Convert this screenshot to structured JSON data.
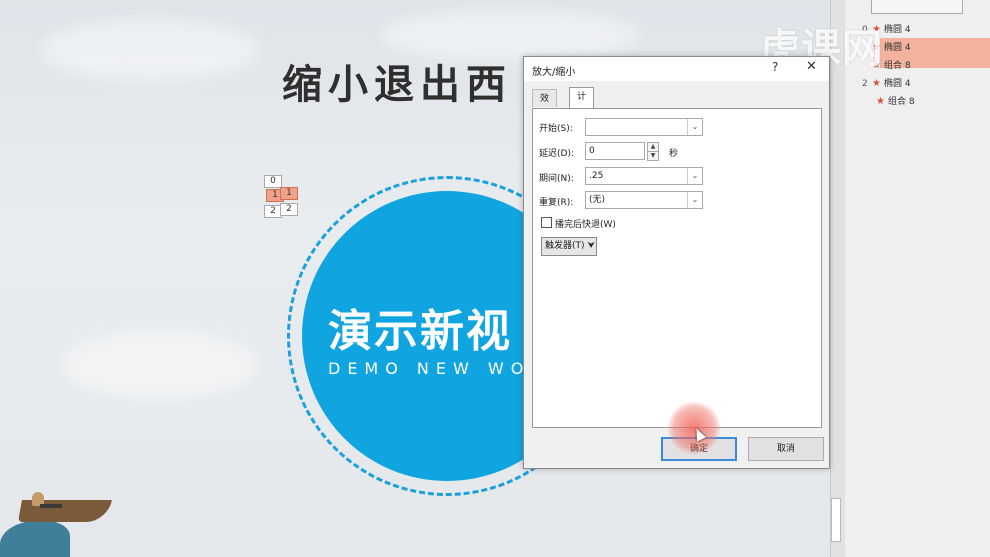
{
  "slide": {
    "title": "缩小退出西",
    "circle_cn": "演示新视",
    "circle_en": "DEMO NEW WO",
    "tags": [
      "0",
      "1",
      "1",
      "2",
      "2"
    ]
  },
  "watermark": "虎课网",
  "pane": {
    "rows": [
      {
        "num": "0",
        "label": "椭圆 4"
      },
      {
        "num": "",
        "label": "椭圆 4"
      },
      {
        "num": "",
        "label": "组合 8"
      },
      {
        "num": "2",
        "label": "椭圆 4"
      },
      {
        "num": "",
        "label": "组合 8"
      }
    ]
  },
  "dialog": {
    "title": "放大/缩小",
    "help": "?",
    "close": "✕",
    "tabs": [
      "效果",
      "计时"
    ],
    "start_label": "开始(S):",
    "start_value": "",
    "delay_label": "延迟(D):",
    "delay_value": "0",
    "delay_unit": "秒",
    "duration_label": "期间(N):",
    "duration_value": ".25",
    "repeat_label": "重复(R):",
    "repeat_value": "(无)",
    "rewind_label": "播完后快退(W)",
    "trigger_label": "触发器(T) ⮟",
    "ok_label": "确定",
    "cancel_label": "取消"
  }
}
